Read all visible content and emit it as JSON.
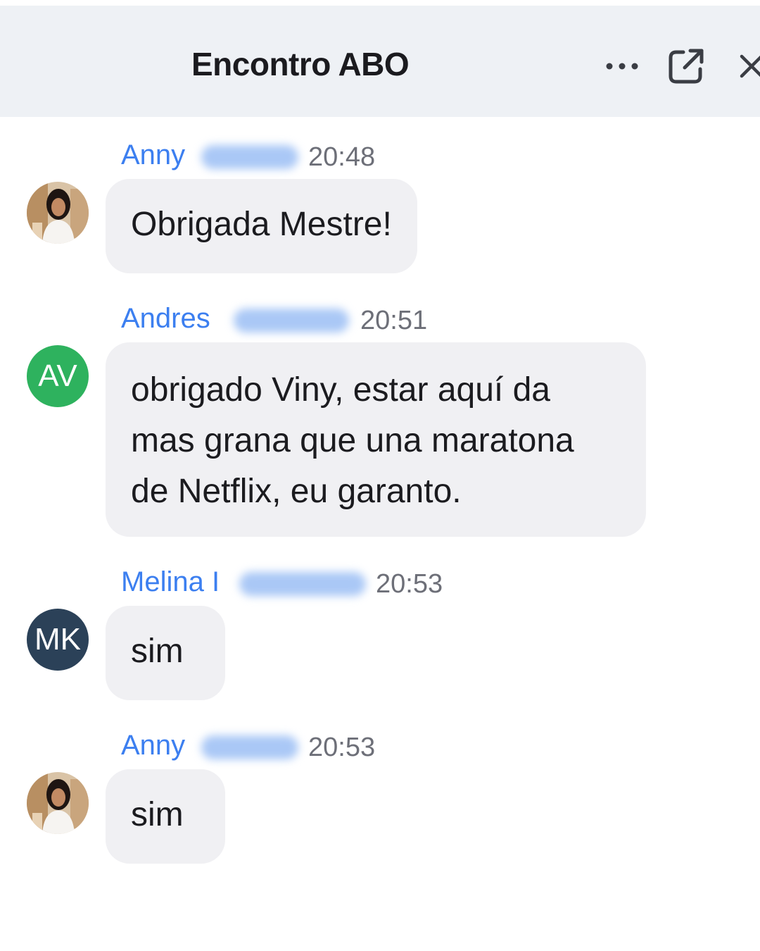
{
  "header": {
    "title": "Encontro ABO",
    "icons": [
      "more-options-icon",
      "pop-out-icon",
      "close-icon"
    ]
  },
  "messages": [
    {
      "sender": "Anny",
      "time": "20:48",
      "text": "Obrigada Mestre!",
      "avatar": {
        "type": "photo"
      }
    },
    {
      "sender": "Andres",
      "time": "20:51",
      "text": "obrigado Viny, estar aquí da mas grana que una maratona de Netflix, eu garanto.",
      "avatar": {
        "type": "initials",
        "initials": "AV",
        "color": "#2eb25e"
      }
    },
    {
      "sender": "Melina I",
      "time": "20:53",
      "text": "sim",
      "avatar": {
        "type": "initials",
        "initials": "MK",
        "color": "#2b4158"
      }
    },
    {
      "sender": "Anny",
      "time": "20:53",
      "text": "sim",
      "avatar": {
        "type": "photo"
      }
    }
  ],
  "colors": {
    "sender_name": "#3c7ff0",
    "header_bg": "#eef1f5",
    "bubble_bg": "#f0f0f3"
  }
}
